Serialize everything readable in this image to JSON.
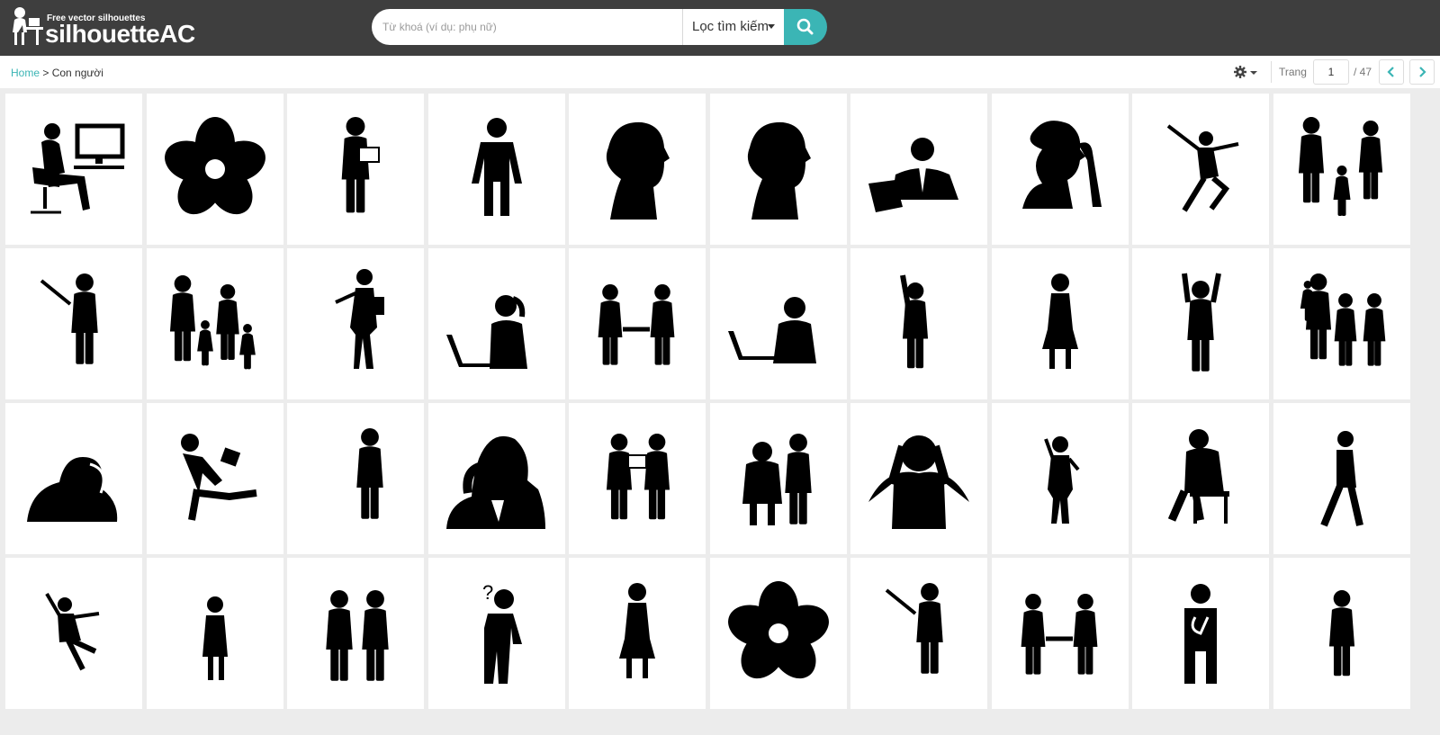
{
  "header": {
    "logo_tagline": "Free vector silhouettes",
    "logo_name": "silhouetteAC",
    "search_placeholder": "Từ khoá (ví dụ: phụ nữ)",
    "filter_label": "Lọc tìm kiếm",
    "search_button_icon": "search-icon"
  },
  "breadcrumb": {
    "home": "Home",
    "separator": " > ",
    "current": "Con người"
  },
  "pagination": {
    "label": "Trang",
    "current_page": "1",
    "total_text": "/ 47"
  },
  "colors": {
    "header_bg": "#3e3e3e",
    "accent": "#3bb5b5",
    "page_bg": "#ececec"
  },
  "gallery": {
    "items": [
      "man-at-computer",
      "flower",
      "businessman-with-folder",
      "person-icon",
      "woman-head-profile",
      "woman-head-profile",
      "businessman-with-laptop",
      "woman-thinking",
      "jumping-girl",
      "family",
      "presenter-with-pointer",
      "family-with-children",
      "woman-with-clipboard",
      "woman-at-laptop",
      "handshake",
      "man-at-laptop",
      "man-raising-fist",
      "standing-woman",
      "man-cheering",
      "family-group",
      "man-head-in-hands",
      "running-businessman",
      "standing-businessman",
      "man-holding-head",
      "two-men-reading",
      "elderly-couple",
      "stressed-man",
      "woman-on-phone",
      "man-sitting-thinking",
      "walking-boy",
      "dancing-girl",
      "girl-standing",
      "two-businessmen",
      "person-question-icon",
      "standing-woman",
      "flower",
      "presenter-with-pointer",
      "handshake",
      "person-thinking-icon",
      "standing-man"
    ]
  }
}
